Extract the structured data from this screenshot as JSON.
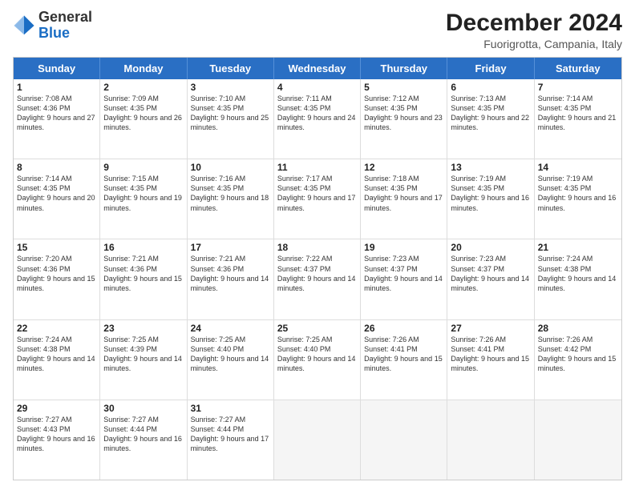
{
  "logo": {
    "general": "General",
    "blue": "Blue"
  },
  "title": "December 2024",
  "location": "Fuorigrotta, Campania, Italy",
  "days": [
    "Sunday",
    "Monday",
    "Tuesday",
    "Wednesday",
    "Thursday",
    "Friday",
    "Saturday"
  ],
  "rows": [
    [
      {
        "day": "1",
        "sunrise": "7:08 AM",
        "sunset": "4:36 PM",
        "daylight": "9 hours and 27 minutes."
      },
      {
        "day": "2",
        "sunrise": "7:09 AM",
        "sunset": "4:35 PM",
        "daylight": "9 hours and 26 minutes."
      },
      {
        "day": "3",
        "sunrise": "7:10 AM",
        "sunset": "4:35 PM",
        "daylight": "9 hours and 25 minutes."
      },
      {
        "day": "4",
        "sunrise": "7:11 AM",
        "sunset": "4:35 PM",
        "daylight": "9 hours and 24 minutes."
      },
      {
        "day": "5",
        "sunrise": "7:12 AM",
        "sunset": "4:35 PM",
        "daylight": "9 hours and 23 minutes."
      },
      {
        "day": "6",
        "sunrise": "7:13 AM",
        "sunset": "4:35 PM",
        "daylight": "9 hours and 22 minutes."
      },
      {
        "day": "7",
        "sunrise": "7:14 AM",
        "sunset": "4:35 PM",
        "daylight": "9 hours and 21 minutes."
      }
    ],
    [
      {
        "day": "8",
        "sunrise": "7:14 AM",
        "sunset": "4:35 PM",
        "daylight": "9 hours and 20 minutes."
      },
      {
        "day": "9",
        "sunrise": "7:15 AM",
        "sunset": "4:35 PM",
        "daylight": "9 hours and 19 minutes."
      },
      {
        "day": "10",
        "sunrise": "7:16 AM",
        "sunset": "4:35 PM",
        "daylight": "9 hours and 18 minutes."
      },
      {
        "day": "11",
        "sunrise": "7:17 AM",
        "sunset": "4:35 PM",
        "daylight": "9 hours and 17 minutes."
      },
      {
        "day": "12",
        "sunrise": "7:18 AM",
        "sunset": "4:35 PM",
        "daylight": "9 hours and 17 minutes."
      },
      {
        "day": "13",
        "sunrise": "7:19 AM",
        "sunset": "4:35 PM",
        "daylight": "9 hours and 16 minutes."
      },
      {
        "day": "14",
        "sunrise": "7:19 AM",
        "sunset": "4:35 PM",
        "daylight": "9 hours and 16 minutes."
      }
    ],
    [
      {
        "day": "15",
        "sunrise": "7:20 AM",
        "sunset": "4:36 PM",
        "daylight": "9 hours and 15 minutes."
      },
      {
        "day": "16",
        "sunrise": "7:21 AM",
        "sunset": "4:36 PM",
        "daylight": "9 hours and 15 minutes."
      },
      {
        "day": "17",
        "sunrise": "7:21 AM",
        "sunset": "4:36 PM",
        "daylight": "9 hours and 14 minutes."
      },
      {
        "day": "18",
        "sunrise": "7:22 AM",
        "sunset": "4:37 PM",
        "daylight": "9 hours and 14 minutes."
      },
      {
        "day": "19",
        "sunrise": "7:23 AM",
        "sunset": "4:37 PM",
        "daylight": "9 hours and 14 minutes."
      },
      {
        "day": "20",
        "sunrise": "7:23 AM",
        "sunset": "4:37 PM",
        "daylight": "9 hours and 14 minutes."
      },
      {
        "day": "21",
        "sunrise": "7:24 AM",
        "sunset": "4:38 PM",
        "daylight": "9 hours and 14 minutes."
      }
    ],
    [
      {
        "day": "22",
        "sunrise": "7:24 AM",
        "sunset": "4:38 PM",
        "daylight": "9 hours and 14 minutes."
      },
      {
        "day": "23",
        "sunrise": "7:25 AM",
        "sunset": "4:39 PM",
        "daylight": "9 hours and 14 minutes."
      },
      {
        "day": "24",
        "sunrise": "7:25 AM",
        "sunset": "4:40 PM",
        "daylight": "9 hours and 14 minutes."
      },
      {
        "day": "25",
        "sunrise": "7:25 AM",
        "sunset": "4:40 PM",
        "daylight": "9 hours and 14 minutes."
      },
      {
        "day": "26",
        "sunrise": "7:26 AM",
        "sunset": "4:41 PM",
        "daylight": "9 hours and 15 minutes."
      },
      {
        "day": "27",
        "sunrise": "7:26 AM",
        "sunset": "4:41 PM",
        "daylight": "9 hours and 15 minutes."
      },
      {
        "day": "28",
        "sunrise": "7:26 AM",
        "sunset": "4:42 PM",
        "daylight": "9 hours and 15 minutes."
      }
    ],
    [
      {
        "day": "29",
        "sunrise": "7:27 AM",
        "sunset": "4:43 PM",
        "daylight": "9 hours and 16 minutes."
      },
      {
        "day": "30",
        "sunrise": "7:27 AM",
        "sunset": "4:44 PM",
        "daylight": "9 hours and 16 minutes."
      },
      {
        "day": "31",
        "sunrise": "7:27 AM",
        "sunset": "4:44 PM",
        "daylight": "9 hours and 17 minutes."
      },
      null,
      null,
      null,
      null
    ]
  ],
  "labels": {
    "sunrise": "Sunrise:",
    "sunset": "Sunset:",
    "daylight": "Daylight:"
  }
}
